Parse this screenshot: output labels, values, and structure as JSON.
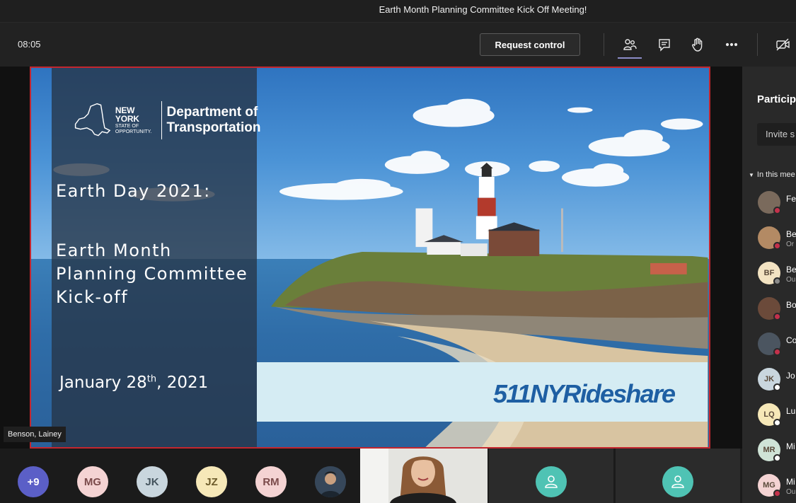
{
  "window": {
    "title": "Earth Month Planning Committee Kick Off Meeting!"
  },
  "toolbar": {
    "timer": "08:05",
    "request_control_label": "Request control"
  },
  "slide": {
    "ny_brand": "NEW YORK",
    "ny_sub1": "STATE OF",
    "ny_sub2": "OPPORTUNITY.",
    "dept_line1": "Department of",
    "dept_line2": "Transportation",
    "heading1": "Earth Day 2021:",
    "heading2_line1": "Earth Month",
    "heading2_line2": "Planning Committee",
    "heading2_line3": "Kick-off",
    "date_prefix": "January 28",
    "date_suffix": "th",
    "date_year": ", 2021",
    "brand_logo": "511NYRideshare"
  },
  "presenter": {
    "name": "Benson, Lainey"
  },
  "participants_panel": {
    "title": "Particip",
    "invite_placeholder": "Invite s",
    "section_label": "In this mee",
    "people": [
      {
        "initials": "",
        "name": "Fe",
        "sub": "",
        "status": "#c4314b",
        "avatar_color": "#7a6a5c"
      },
      {
        "initials": "",
        "name": "Be",
        "sub": "Or",
        "status": "#c4314b",
        "avatar_color": "#b38a64"
      },
      {
        "initials": "BF",
        "name": "Be",
        "sub": "Ou",
        "status": "#8a8a8a",
        "avatar_color": "#f3e3c2"
      },
      {
        "initials": "",
        "name": "Bo",
        "sub": "",
        "status": "#c4314b",
        "avatar_color": "#6b4a3a"
      },
      {
        "initials": "",
        "name": "Co",
        "sub": "",
        "status": "#c4314b",
        "avatar_color": "#4b5560"
      },
      {
        "initials": "JK",
        "name": "Jo",
        "sub": "",
        "status": "#ffffff",
        "avatar_color": "#c9d6de"
      },
      {
        "initials": "LQ",
        "name": "Lu",
        "sub": "",
        "status": "#ffffff",
        "avatar_color": "#f6e8b8"
      },
      {
        "initials": "MR",
        "name": "Mi",
        "sub": "",
        "status": "#ffffff",
        "avatar_color": "#cfe3d6"
      },
      {
        "initials": "MG",
        "name": "Mi",
        "sub": "Ou",
        "status": "#c4314b",
        "avatar_color": "#f4d3d3"
      }
    ]
  },
  "bottom_bar": {
    "overflow_count": "+9",
    "avatars": [
      {
        "initials": "MG",
        "color": "#f4d3d3",
        "text_color": "#7a4a4a"
      },
      {
        "initials": "JK",
        "color": "#c9d6de",
        "text_color": "#44535d"
      },
      {
        "initials": "JZ",
        "color": "#f6e8b8",
        "text_color": "#6b5a2a"
      },
      {
        "initials": "RM",
        "color": "#f4d3d3",
        "text_color": "#7a4a4a"
      }
    ]
  },
  "colors": {
    "accent": "#6264a7",
    "share_border": "#c4262e",
    "teal_avatar": "#4fc3b4"
  }
}
